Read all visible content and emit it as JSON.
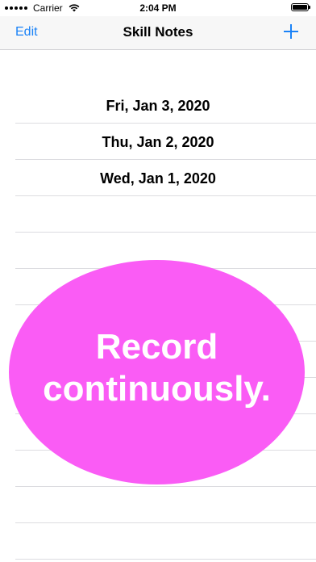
{
  "status_bar": {
    "carrier": "Carrier",
    "time": "2:04 PM"
  },
  "nav": {
    "edit_label": "Edit",
    "title": "Skill Notes",
    "add_icon": "plus-icon"
  },
  "notes": [
    {
      "label": "Fri, Jan 3, 2020"
    },
    {
      "label": "Thu, Jan 2, 2020"
    },
    {
      "label": "Wed, Jan 1, 2020"
    }
  ],
  "overlay": {
    "line1": "Record",
    "line2": "continuously.",
    "color": "#fa5cf5"
  },
  "colors": {
    "accent": "#1a82f7",
    "separator": "#dcdce0",
    "nav_background": "#f7f7f7"
  }
}
